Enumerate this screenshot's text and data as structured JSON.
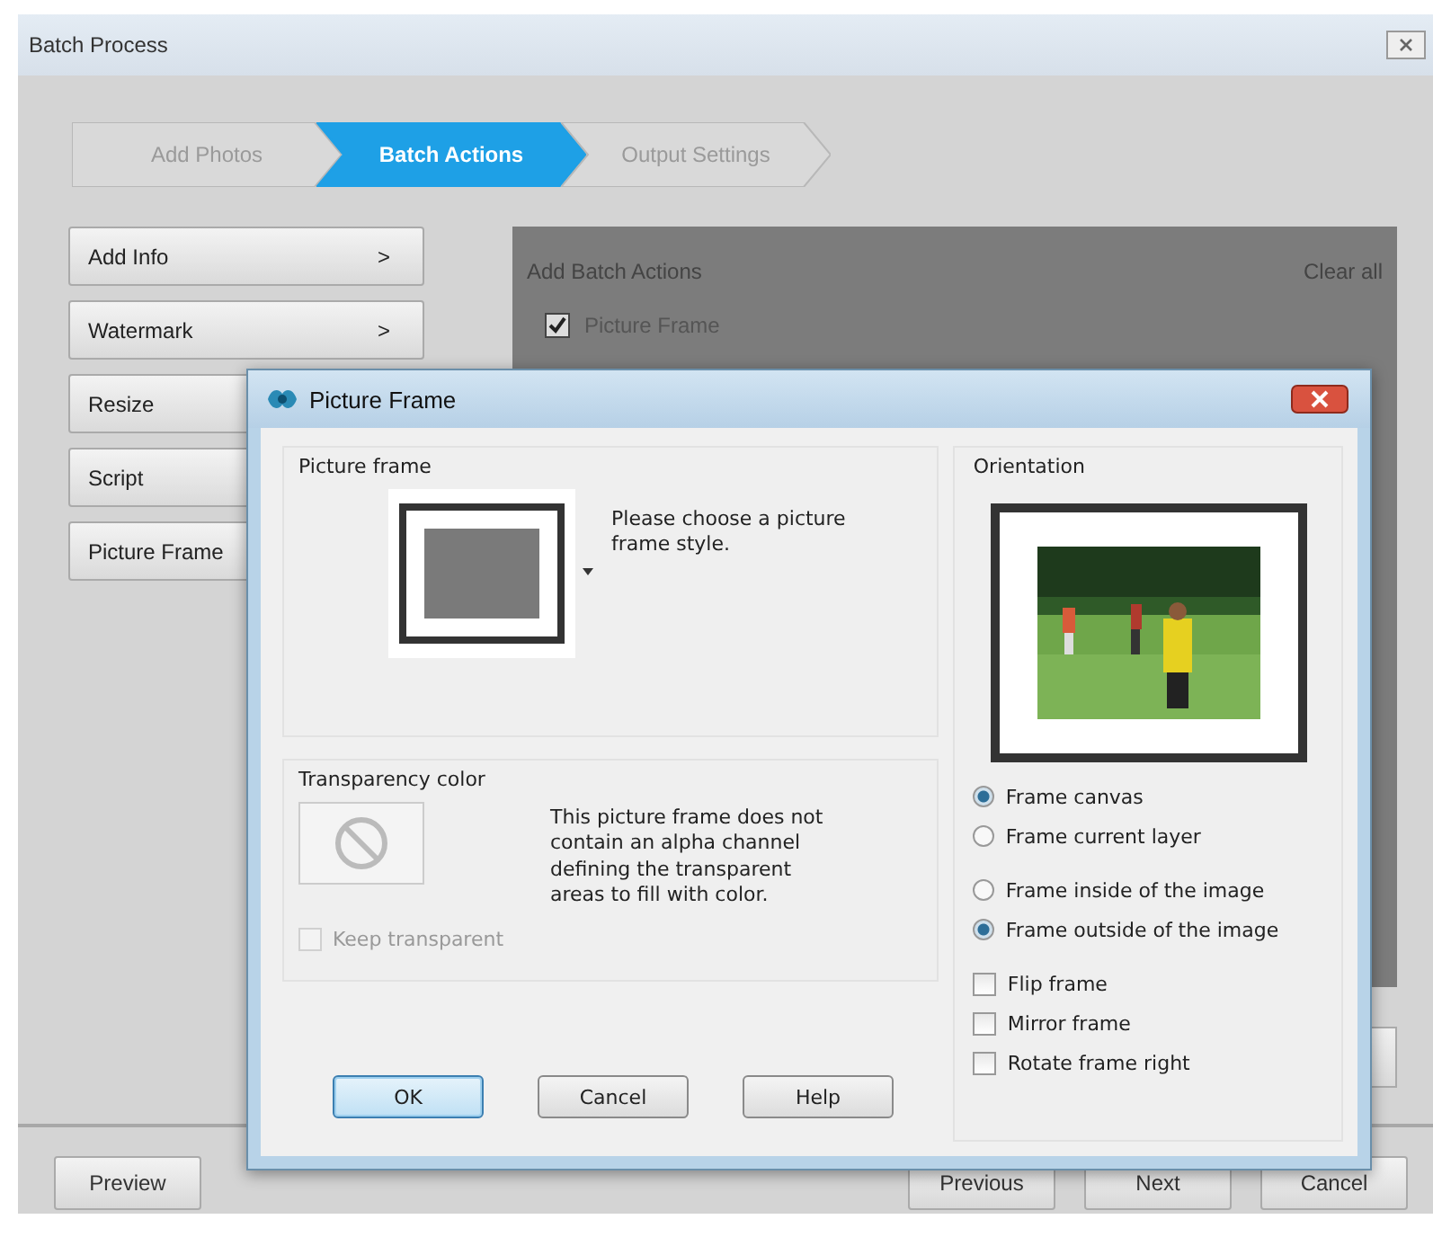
{
  "window": {
    "title": "Batch Process"
  },
  "steps": [
    {
      "label": "Add Photos",
      "selected": false
    },
    {
      "label": "Batch Actions",
      "selected": true
    },
    {
      "label": "Output Settings",
      "selected": false
    }
  ],
  "actions": [
    {
      "label": "Add Info",
      "arrow": ">"
    },
    {
      "label": "Watermark",
      "arrow": ">"
    },
    {
      "label": "Resize"
    },
    {
      "label": "Script"
    },
    {
      "label": "Picture Frame"
    }
  ],
  "panel": {
    "title": "Add Batch Actions",
    "clear": "Clear all",
    "items": [
      {
        "label": "Picture Frame",
        "checked": true
      }
    ]
  },
  "footer": {
    "left": [
      "Preview"
    ],
    "right": [
      "Previous",
      "Next",
      "Cancel"
    ]
  },
  "dialog": {
    "title": "Picture Frame",
    "frame_group": {
      "title": "Picture frame",
      "hint": "Please choose a picture frame style."
    },
    "transparency_group": {
      "title": "Transparency color",
      "message": "This picture frame does not contain an alpha channel defining the transparent areas to fill with color.",
      "keep": {
        "label": "Keep transparent",
        "checked": false,
        "disabled": true
      }
    },
    "buttons": [
      {
        "label": "OK",
        "default": true
      },
      {
        "label": "Cancel",
        "default": false
      },
      {
        "label": "Help",
        "default": false
      }
    ],
    "orientation": {
      "title": "Orientation",
      "target_options": [
        {
          "label": "Frame canvas",
          "selected": true
        },
        {
          "label": "Frame current layer",
          "selected": false
        }
      ],
      "placement_options": [
        {
          "label": "Frame inside of the image",
          "selected": false
        },
        {
          "label": "Frame outside of the image",
          "selected": true
        }
      ],
      "checkboxes": [
        {
          "label": "Flip frame",
          "checked": false
        },
        {
          "label": "Mirror frame",
          "checked": false
        },
        {
          "label": "Rotate frame right",
          "checked": false
        }
      ]
    }
  }
}
